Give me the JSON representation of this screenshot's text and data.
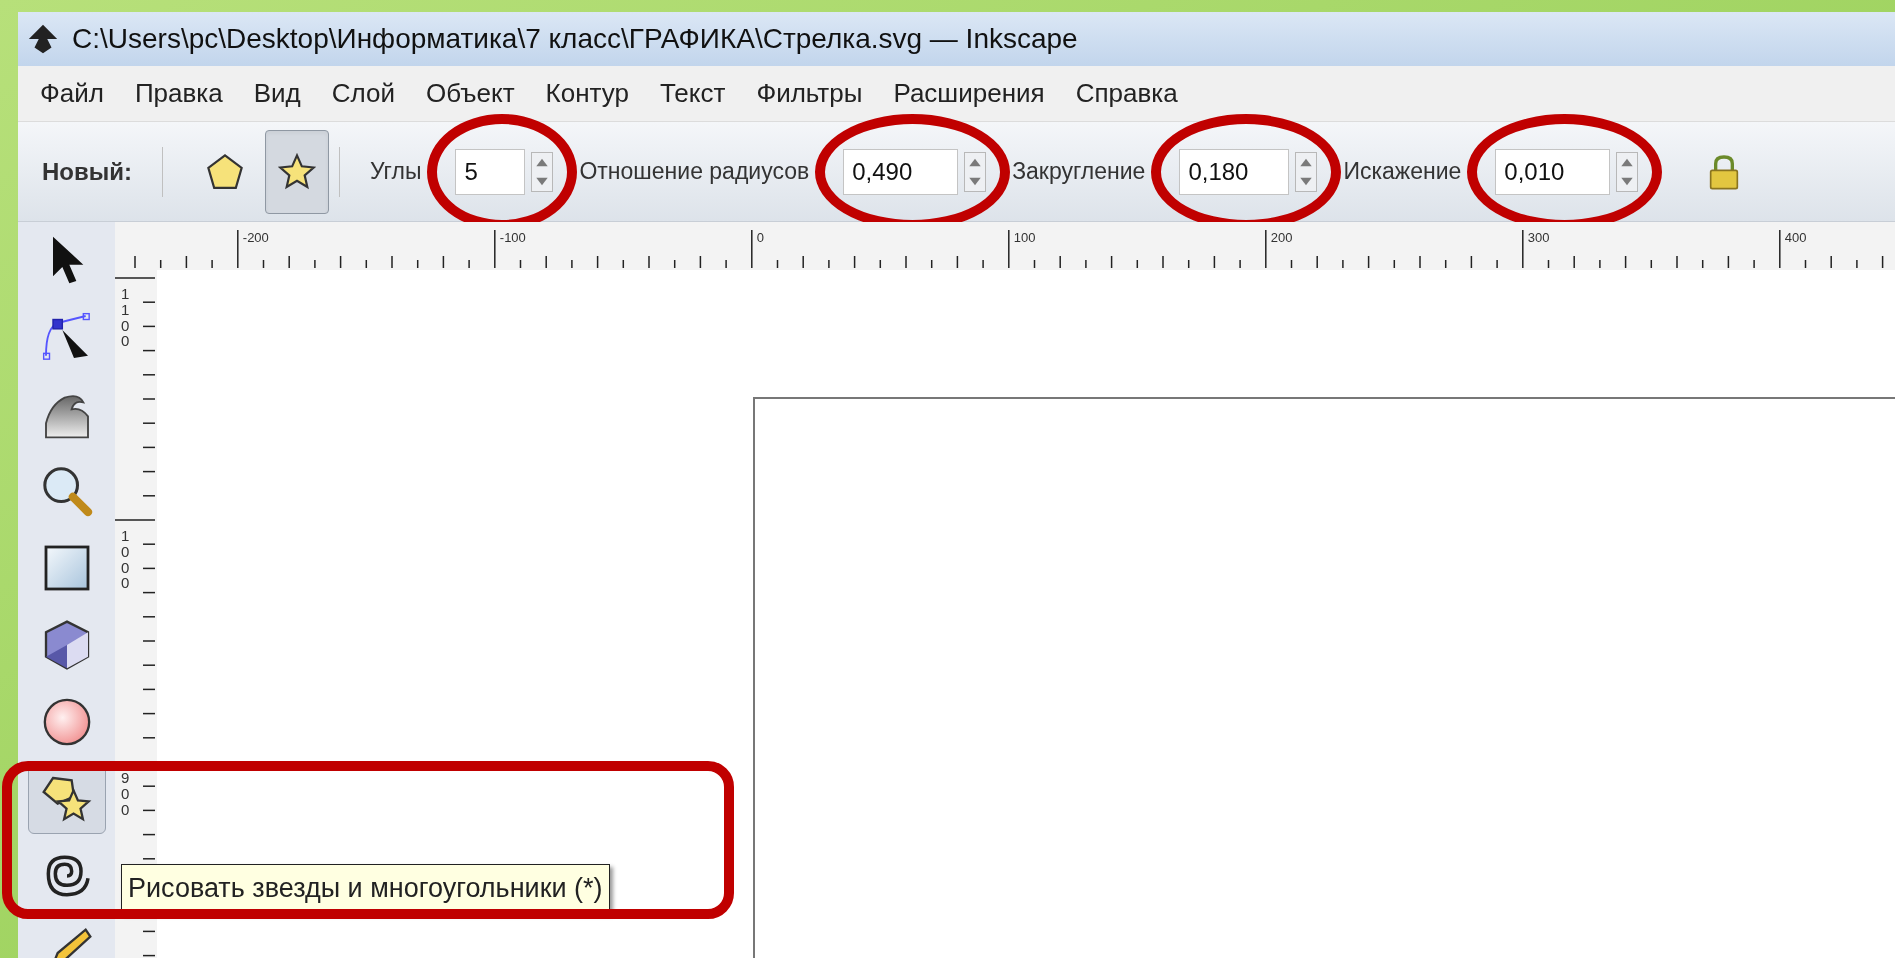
{
  "window": {
    "title": "C:\\Users\\pc\\Desktop\\Информатика\\7 класс\\ГРАФИКА\\Стрелка.svg — Inkscape"
  },
  "menu": [
    "Файл",
    "Правка",
    "Вид",
    "Слой",
    "Объект",
    "Контур",
    "Текст",
    "Фильтры",
    "Расширения",
    "Справка"
  ],
  "toolbar": {
    "label": "Новый:",
    "modes": [
      {
        "kind": "polygon",
        "selected": false
      },
      {
        "kind": "star",
        "selected": true
      }
    ],
    "fields": [
      {
        "label": "Углы",
        "value": "5"
      },
      {
        "label": "Отношение радиусов",
        "value": "0,490"
      },
      {
        "label": "Закругление",
        "value": "0,180"
      },
      {
        "label": "Искажение",
        "value": "0,010"
      }
    ]
  },
  "ruler": {
    "horizontal": [
      "-200",
      "-100",
      "0",
      "100",
      "200",
      "300",
      "400"
    ],
    "vertical": [
      "1100",
      "1000",
      "900"
    ]
  },
  "tools": [
    {
      "kind": "select",
      "selected": false
    },
    {
      "kind": "node",
      "selected": false
    },
    {
      "kind": "tweak",
      "selected": false
    },
    {
      "kind": "zoom",
      "selected": false
    },
    {
      "kind": "rect",
      "selected": false
    },
    {
      "kind": "box3d",
      "selected": false
    },
    {
      "kind": "ellipse",
      "selected": false
    },
    {
      "kind": "star",
      "selected": true
    },
    {
      "kind": "spiral",
      "selected": false
    },
    {
      "kind": "pencil",
      "selected": false
    }
  ],
  "tooltip": "Рисовать звезды и многоугольники (*)"
}
